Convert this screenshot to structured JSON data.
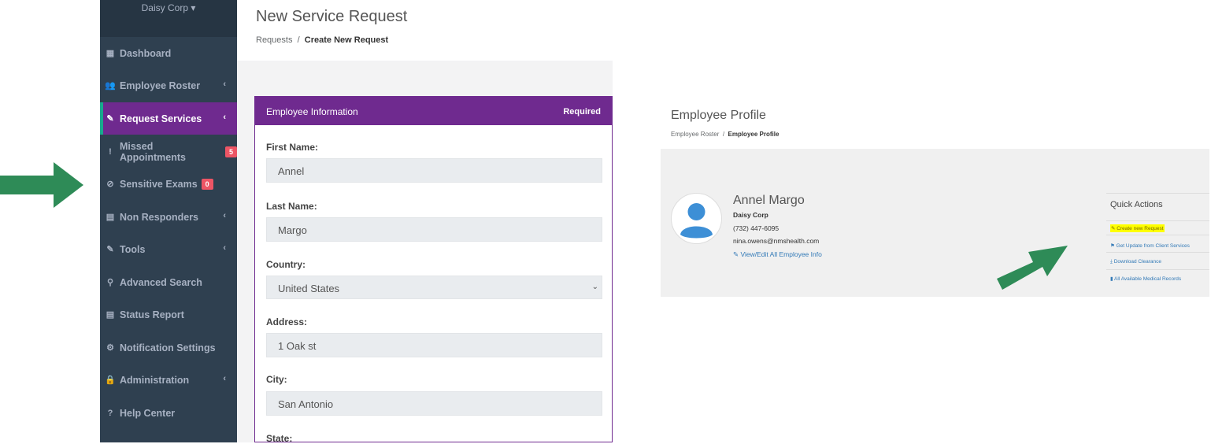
{
  "sidebar": {
    "org": "Daisy Corp ▾",
    "items": [
      {
        "label": "Dashboard",
        "icon": "▦"
      },
      {
        "label": "Employee Roster",
        "icon": "👥"
      },
      {
        "label": "Request Services",
        "icon": "✎"
      },
      {
        "label": "Missed Appointments",
        "icon": "!",
        "badge": "5"
      },
      {
        "label": "Sensitive Exams",
        "icon": "⊘",
        "badge": "0"
      },
      {
        "label": "Non Responders",
        "icon": "▤"
      },
      {
        "label": "Tools",
        "icon": "✎"
      },
      {
        "label": "Advanced Search",
        "icon": "⚲"
      },
      {
        "label": "Status Report",
        "icon": "▤"
      },
      {
        "label": "Notification Settings",
        "icon": "⚙"
      },
      {
        "label": "Administration",
        "icon": "🔒"
      },
      {
        "label": "Help Center",
        "icon": "?"
      }
    ],
    "chevron": "‹"
  },
  "main": {
    "title": "New Service Request",
    "breadcrumb": {
      "parent": "Requests",
      "sep": "/",
      "current": "Create New Request"
    },
    "panel": {
      "title": "Employee Information",
      "required": "Required",
      "fields": [
        {
          "label": "First Name:",
          "value": "Annel"
        },
        {
          "label": "Last Name:",
          "value": "Margo"
        },
        {
          "label": "Country:",
          "value": "United States"
        },
        {
          "label": "Address:",
          "value": "1 Oak st"
        },
        {
          "label": "City:",
          "value": "San Antonio"
        },
        {
          "label": "State:"
        }
      ],
      "select_chevron": "⌄"
    }
  },
  "profile": {
    "title": "Employee Profile",
    "breadcrumb": {
      "parent": "Employee Roster",
      "sep": "/",
      "current": "Employee Profile"
    },
    "name": "Annel Margo",
    "company": "Daisy Corp",
    "phone": "(732) 447-6095",
    "email": "nina.owens@nmshealth.com",
    "view_link": "View/Edit All Employee Info",
    "quick_actions": {
      "title": "Quick Actions",
      "items": [
        "Create new Request",
        "Get Update from Client Services",
        "Download Clearance",
        "All Available Medical Records"
      ]
    }
  },
  "colors": {
    "sidebar_bg": "#2f4050",
    "accent_purple": "#6f2a8f",
    "badge_red": "#ed5565",
    "arrow_green": "#2e8b57",
    "highlight": "#ffff00"
  }
}
